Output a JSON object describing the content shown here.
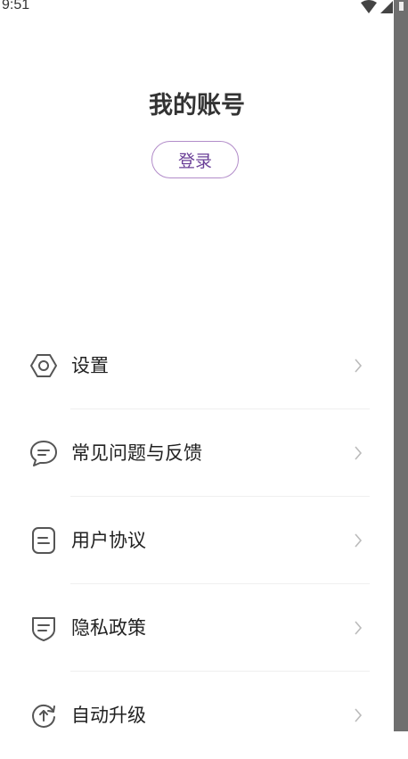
{
  "status_bar": {
    "time": "9:51"
  },
  "header": {
    "title": "我的账号",
    "login_label": "登录"
  },
  "menu": {
    "items": [
      {
        "label": "设置",
        "icon": "gear-hex-icon"
      },
      {
        "label": "常见问题与反馈",
        "icon": "chat-bubble-icon"
      },
      {
        "label": "用户协议",
        "icon": "document-icon"
      },
      {
        "label": "隐私政策",
        "icon": "shield-icon"
      },
      {
        "label": "自动升级",
        "icon": "refresh-upload-icon"
      }
    ]
  },
  "colors": {
    "accent": "#6a3f97",
    "accent_border": "#b28cc9",
    "icon": "#555555",
    "chevron": "#bbbbbb"
  }
}
